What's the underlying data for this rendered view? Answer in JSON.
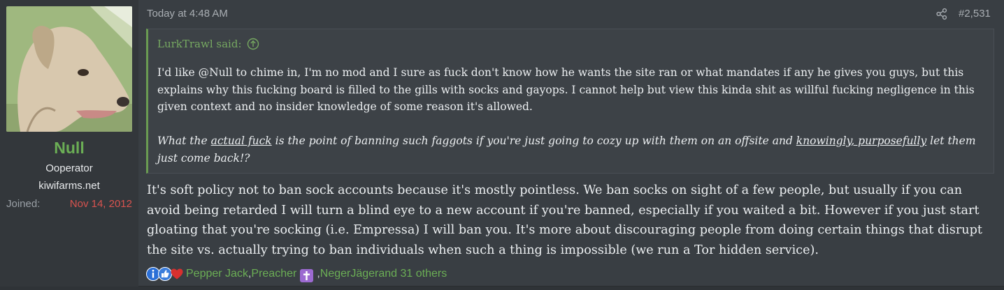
{
  "user": {
    "name": "Null",
    "title": "Ooperator",
    "banner": "kiwifarms.net",
    "joined_label": "Joined:",
    "joined_value": "Nov 14, 2012",
    "avatar_icon": "dog-avatar"
  },
  "post": {
    "timestamp": "Today at 4:48 AM",
    "number": "#2,531",
    "share_icon": "share-icon"
  },
  "quote": {
    "author": "LurkTrawl said:",
    "para1": "I'd like @Null to chime in, I'm no mod and I sure as fuck don't know how he wants the site ran or what mandates if any he gives you guys, but this explains why this fucking board is filled to the gills with socks and gayops. I cannot help but view this kinda shit as willful fucking negligence in this given context and no insider knowledge of some reason it's allowed.",
    "para2_a": "What the ",
    "para2_u1": "actual fuck",
    "para2_b": " is the point of banning such faggots if you're just going to cozy up with them on an offsite and ",
    "para2_u2": "knowingly, purposefully",
    "para2_c": " let them just come back!?"
  },
  "reply": {
    "text": "It's soft policy not to ban sock accounts because it's mostly pointless. We ban socks on sight of a few people, but usually if you can avoid being retarded I will turn a blind eye to a new account if you're banned, especially if you waited a bit. However if you just start gloating that you're socking (i.e. Empressa) I will ban you. It's more about discouraging people from doing certain things that disrupt the site vs. actually trying to ban individuals when such a thing is impossible (we run a Tor hidden service)."
  },
  "reactions": {
    "user1": "Pepper Jack",
    "sep1": ", ",
    "user2": "Preacher",
    "sep2": ", ",
    "user3": "NegerJäger",
    "tail": " and 31 others",
    "icons": [
      "info-reaction-icon",
      "thumbs-up-reaction-icon",
      "heart-reaction-icon"
    ]
  },
  "colors": {
    "accent_green": "#6bae55",
    "joined_red": "#d9534f",
    "background": "#393e43"
  }
}
